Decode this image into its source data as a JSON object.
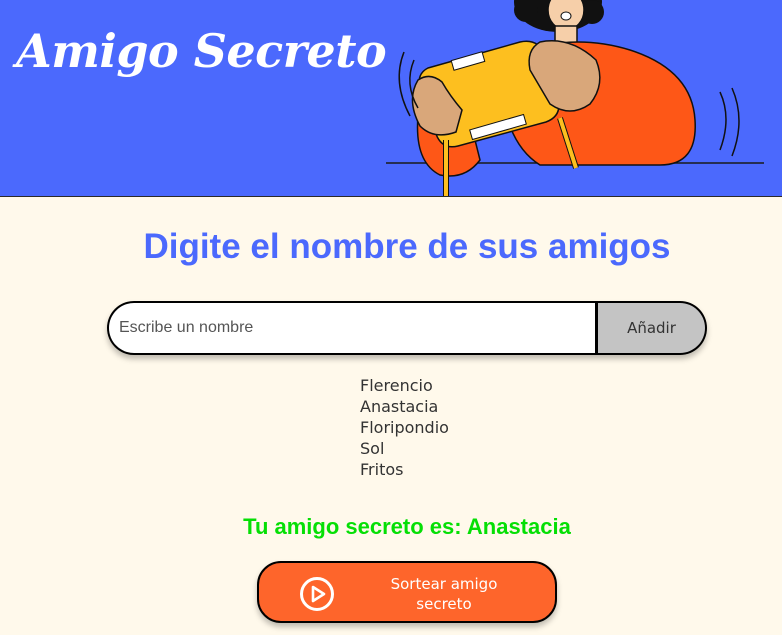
{
  "header": {
    "title": "Amigo Secreto",
    "background_color": "#4b69fd"
  },
  "main": {
    "background_color": "#fff9eb",
    "section_title": "Digite el nombre de sus amigos",
    "input": {
      "placeholder": "Escribe un nombre",
      "value": ""
    },
    "add_button_label": "Añadir",
    "friends": [
      "Flerencio",
      "Anastacia",
      "Floripondio",
      "Sol",
      "Fritos"
    ],
    "result_text": "Tu amigo secreto es: Anastacia",
    "draw_button_label": "Sortear amigo secreto",
    "draw_button_icon": "play-circle-icon",
    "accent_color": "#fe652b",
    "result_color": "#05df05"
  }
}
